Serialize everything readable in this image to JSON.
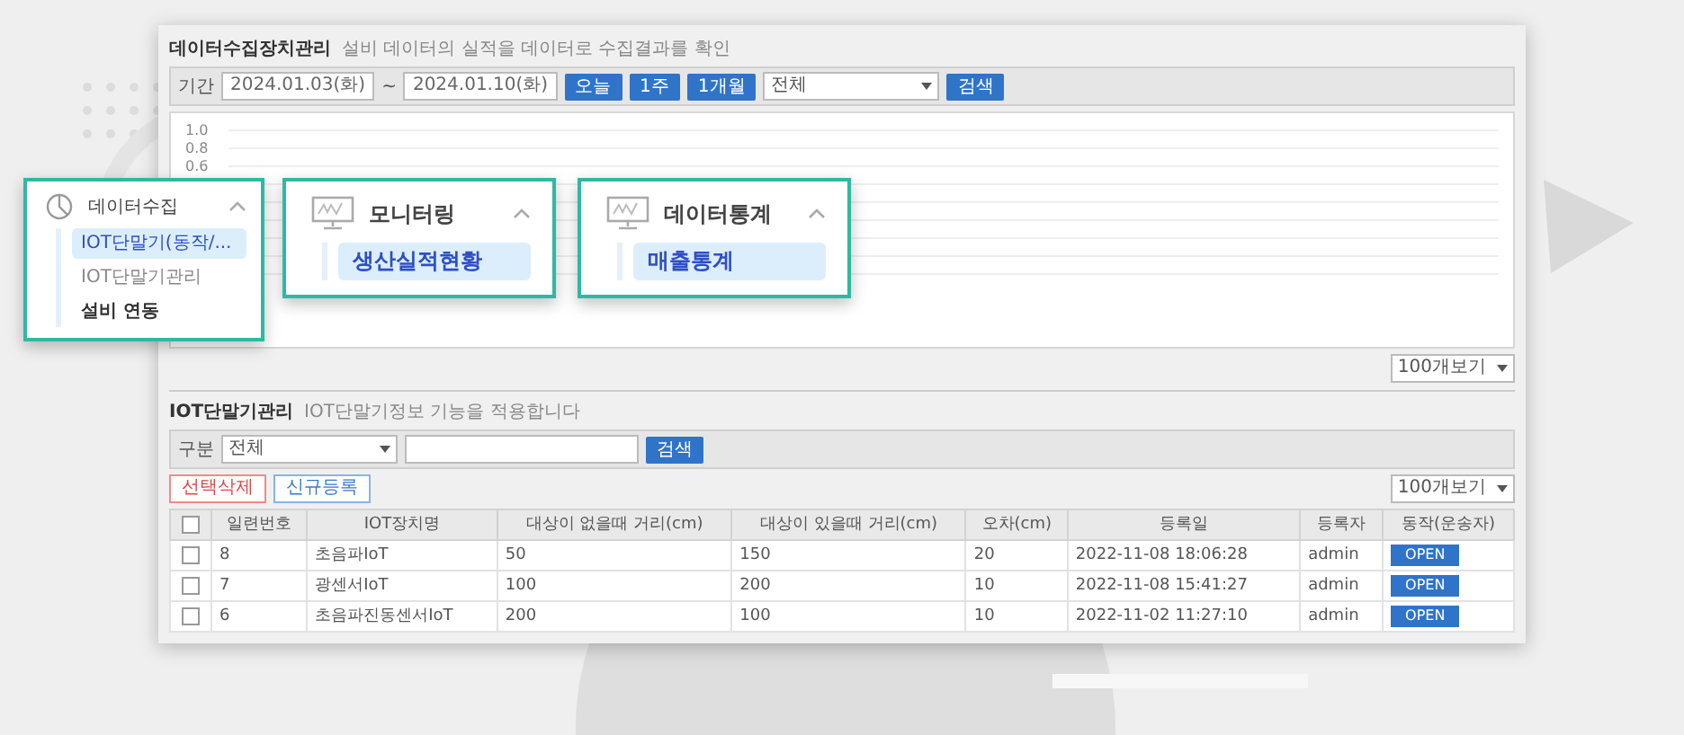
{
  "top_panel": {
    "title": "데이터수집장치관리",
    "description": "설비 데이터의 실적을 데이터로 수집결과를 확인",
    "filter": {
      "label": "기간",
      "start_date": "2024.01.03(화)",
      "separator": "~",
      "end_date": "2024.01.10(화)",
      "range_buttons": [
        "오늘",
        "1주",
        "1개월"
      ],
      "select": "전체",
      "search_button": "검색"
    },
    "chart_y_ticks": [
      "1.0",
      "0.8",
      "0.6"
    ],
    "page_size_select": "100개보기"
  },
  "callouts": [
    {
      "title": "데이터수집",
      "items": [
        {
          "label": "IOT단말기(동작/...",
          "selected": true,
          "emphasized": false
        },
        {
          "label": "IOT단말기관리",
          "selected": false,
          "emphasized": false
        },
        {
          "label": "설비 연동",
          "selected": false,
          "emphasized": true
        }
      ]
    },
    {
      "title": "모니터링",
      "items": [
        {
          "label": "생산실적현황",
          "selected": true
        }
      ]
    },
    {
      "title": "데이터통계",
      "items": [
        {
          "label": "매출통계",
          "selected": true
        }
      ]
    }
  ],
  "bottom_panel": {
    "title": "IOT단말기관리",
    "description": "IOT단말기정보 기능을 적용합니다",
    "filter": {
      "label": "구분",
      "select": "전체",
      "search_button": "검색"
    },
    "action_buttons": [
      {
        "label": "선택삭제",
        "kind": "danger"
      },
      {
        "label": "신규등록",
        "kind": "primary"
      }
    ],
    "page_size_select": "100개보기",
    "table": {
      "header_checked": false,
      "columns": [
        "일련번호",
        "IOT장치명",
        "대상이 없을때 거리(cm)",
        "대상이 있을때 거리(cm)",
        "오차(cm)",
        "등록일",
        "등록자",
        "동작(운송자)"
      ],
      "rows": [
        {
          "checked": false,
          "cells": [
            "8",
            "초음파IoT",
            "50",
            "150",
            "20",
            "2022-11-08 18:06:28",
            "admin"
          ],
          "action": "OPEN"
        },
        {
          "checked": false,
          "cells": [
            "7",
            "광센서IoT",
            "100",
            "200",
            "10",
            "2022-11-08 15:41:27",
            "admin"
          ],
          "action": "OPEN"
        },
        {
          "checked": false,
          "cells": [
            "6",
            "초음파진동센서IoT",
            "200",
            "100",
            "10",
            "2022-11-02 11:27:10",
            "admin"
          ],
          "action": "OPEN"
        }
      ]
    }
  }
}
